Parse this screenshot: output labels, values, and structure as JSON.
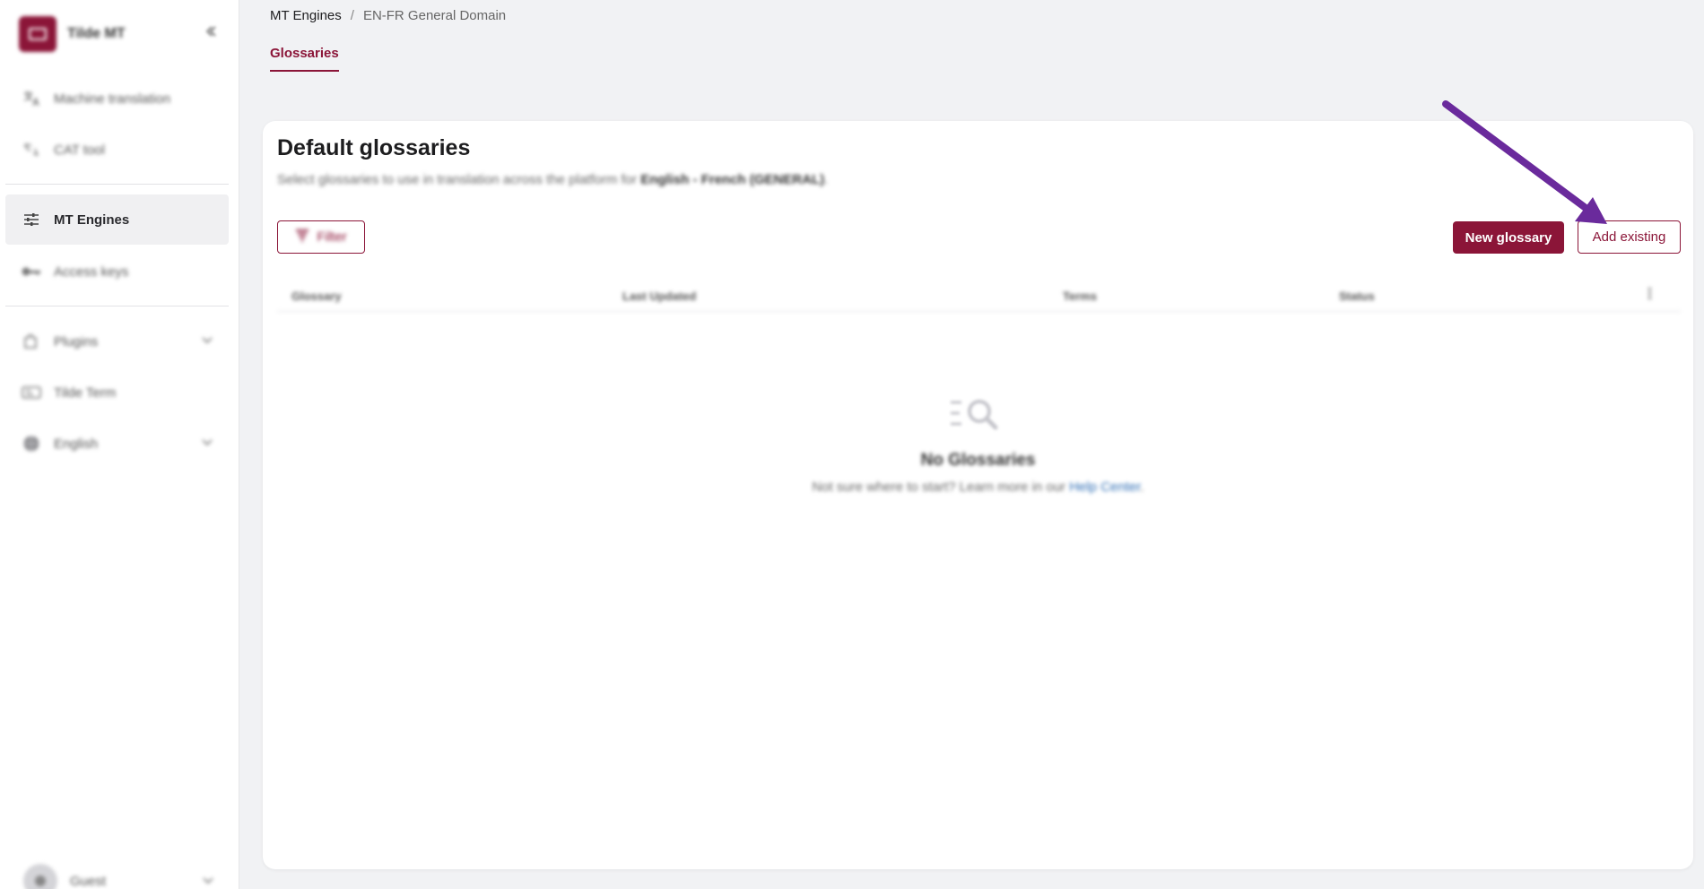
{
  "sidebar": {
    "brand_name": "Tilde MT",
    "items": [
      {
        "label": "Machine translation",
        "icon": "translate-icon"
      },
      {
        "label": "CAT tool",
        "icon": "cat-tool-icon"
      },
      {
        "label": "MT Engines",
        "icon": "sliders-icon",
        "active": true
      },
      {
        "label": "Access keys",
        "icon": "key-icon"
      },
      {
        "label": "Plugins",
        "icon": "plugin-icon",
        "expandable": true
      },
      {
        "label": "Tilde Term",
        "icon": "term-icon"
      },
      {
        "label": "English",
        "icon": "globe-icon",
        "expandable": true
      }
    ],
    "user": {
      "name": "Guest"
    }
  },
  "breadcrumb": {
    "root": "MT Engines",
    "separator": "/",
    "current": "EN-FR General Domain"
  },
  "tabs": [
    {
      "label": "Glossaries",
      "active": true
    }
  ],
  "card": {
    "title": "Default glossaries",
    "subtitle_prefix": "Select glossaries to use in translation across the platform for ",
    "subtitle_bold": "English - French (GENERAL)",
    "subtitle_suffix": ".",
    "filter_label": "Filter",
    "new_glossary_label": "New glossary",
    "add_existing_label": "Add existing"
  },
  "table": {
    "columns": [
      "Glossary",
      "Last Updated",
      "Terms",
      "Status"
    ]
  },
  "empty_state": {
    "title": "No Glossaries",
    "text_prefix": "Not sure where to start? Learn more in our ",
    "link_text": "Help Center",
    "text_suffix": "."
  },
  "colors": {
    "accent": "#8b1538",
    "annotation_arrow": "#6a2a9c",
    "link": "#2e6db4"
  }
}
